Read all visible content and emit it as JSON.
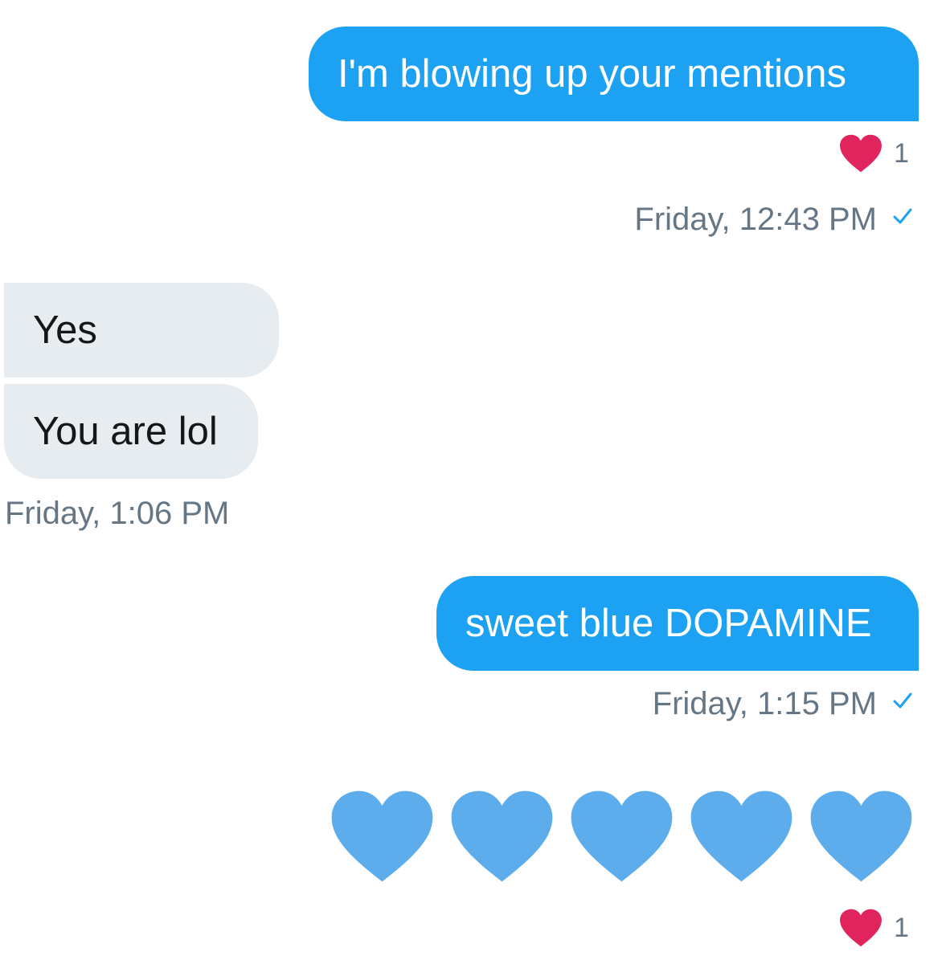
{
  "colors": {
    "sent_bubble": "#1da1f2",
    "received_bubble": "#e6ecf0",
    "timestamp_text": "#657786",
    "read_check": "#1da1f2",
    "reaction_heart": "#e0245e",
    "emoji_heart": "#5dadec"
  },
  "messages": [
    {
      "direction": "sent",
      "text": "I'm blowing up your mentions",
      "reaction": {
        "icon": "red-heart-icon",
        "count": "1"
      },
      "timestamp": "Friday, 12:43 PM",
      "read": true
    },
    {
      "direction": "received",
      "text": "Yes"
    },
    {
      "direction": "received",
      "text": "You are lol",
      "timestamp": "Friday, 1:06 PM"
    },
    {
      "direction": "sent",
      "text": "sweet blue DOPAMINE",
      "timestamp": "Friday, 1:15 PM",
      "read": true
    },
    {
      "direction": "sent",
      "emoji": [
        "blue-heart-icon",
        "blue-heart-icon",
        "blue-heart-icon",
        "blue-heart-icon",
        "blue-heart-icon"
      ],
      "reaction": {
        "icon": "red-heart-icon",
        "count": "1"
      }
    }
  ]
}
